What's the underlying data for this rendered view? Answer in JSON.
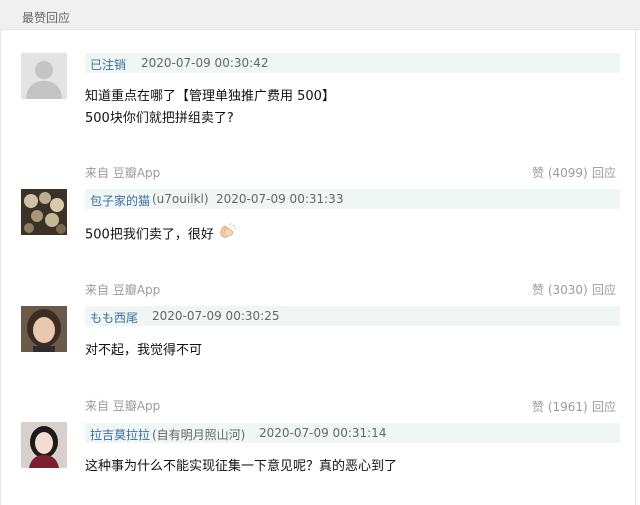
{
  "section_title": "最赞回应",
  "comments": [
    {
      "author": "已注销",
      "author_tag": "",
      "time": "2020-07-09 00:30:42",
      "lines": [
        "知道重点在哪了【管理单独推广费用 500】",
        "500块你们就把拼组卖了?"
      ],
      "source": "来自 豆瓣App",
      "likes": "赞 (4099)",
      "reply": "回应"
    },
    {
      "author": "包子家的猫",
      "author_tag": "(u7ouilkl)",
      "time": "2020-07-09 00:31:33",
      "lines": [
        "500把我们卖了，很好"
      ],
      "source": "来自 豆瓣App",
      "likes": "赞 (3030)",
      "reply": "回应"
    },
    {
      "author": "もも西尾",
      "author_tag": "",
      "time": "2020-07-09 00:30:25",
      "lines": [
        "对不起，我觉得不可"
      ],
      "source": "来自 豆瓣App",
      "likes": "赞 (1961)",
      "reply": "回应"
    },
    {
      "author": "拉吉莫拉拉",
      "author_tag": "(自有明月照山河)",
      "time": "2020-07-09 00:31:14",
      "lines": [
        "这种事为什么不能实现征集一下意见呢？真的恶心到了"
      ]
    }
  ]
}
